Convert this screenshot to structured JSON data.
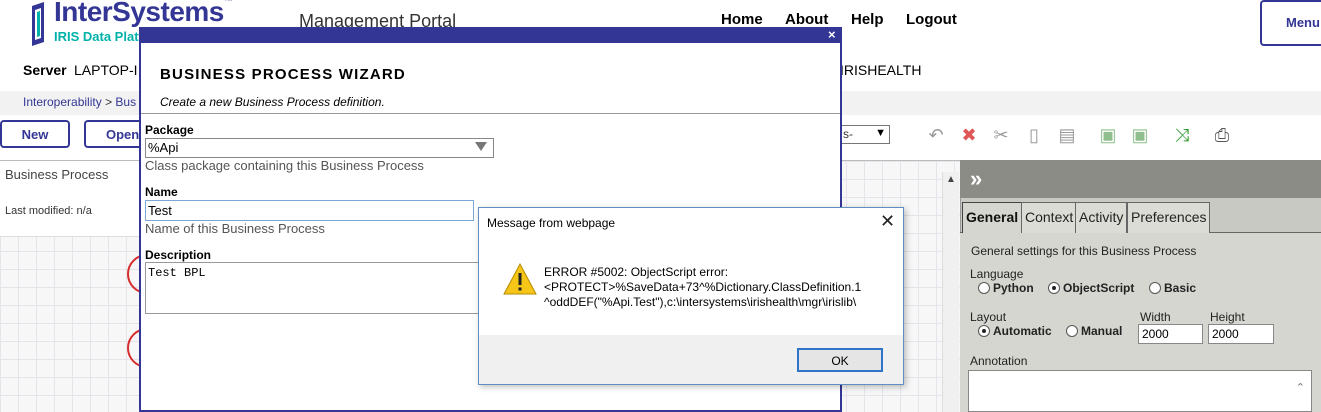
{
  "header": {
    "logo_name": "InterSystems",
    "logo_tm": "™",
    "logo_sub": "IRIS Data Platform",
    "portal_title": "Management Portal",
    "nav": [
      "Home",
      "About",
      "Help",
      "Logout"
    ],
    "menu_label": "Menu",
    "server_label": "Server",
    "server_value": "LAPTOP-I",
    "namespace_value": "IRISHEALTH"
  },
  "breadcrumb": {
    "items": [
      "Interoperability",
      "Bus"
    ],
    "separator": ">"
  },
  "toolbar": {
    "new_label": "New",
    "open_label": "Open",
    "select_value": "s-",
    "icons": [
      "undo-icon",
      "delete-icon",
      "cut-icon",
      "copy-icon",
      "paste-icon",
      "add-activity-icon",
      "group-icon",
      "arrange-icon",
      "print-icon"
    ]
  },
  "diagram": {
    "title": "Business Process",
    "last_modified": "Last modified: n/a"
  },
  "panel": {
    "collapse_glyph": "»",
    "tabs": [
      "General",
      "Context",
      "Activity",
      "Preferences"
    ],
    "active_tab": "General",
    "description": "General settings for this Business Process",
    "language_label": "Language",
    "language_options": [
      "Python",
      "ObjectScript",
      "Basic"
    ],
    "language_selected": "ObjectScript",
    "layout_label": "Layout",
    "layout_options": [
      "Automatic",
      "Manual"
    ],
    "layout_selected": "Automatic",
    "width_label": "Width",
    "width_value": "2000",
    "height_label": "Height",
    "height_value": "2000",
    "annotation_label": "Annotation"
  },
  "wizard": {
    "close_glyph": "×",
    "title": "BUSINESS PROCESS WIZARD",
    "subtitle": "Create a new Business Process definition.",
    "package_label": "Package",
    "package_value": "%Api",
    "package_help": "Class package containing this Business Process",
    "name_label": "Name",
    "name_value": "Test",
    "name_help": "Name of this Business Process",
    "description_label": "Description",
    "description_value": "Test BPL"
  },
  "message": {
    "title": "Message from webpage",
    "close_glyph": "✕",
    "lines": [
      "ERROR #5002: ObjectScript error:",
      "<PROTECT>%SaveData+73^%Dictionary.ClassDefinition.1",
      "^oddDEF(\"%Api.Test\"),c:\\intersystems\\irishealth\\mgr\\irislib\\"
    ],
    "ok_label": "OK"
  },
  "colors": {
    "brand": "#333695",
    "brand_accent": "#00b2a9",
    "panel_bg": "#d6d6d0",
    "panel_header": "#8c8c86",
    "warning": "#f5c518"
  }
}
